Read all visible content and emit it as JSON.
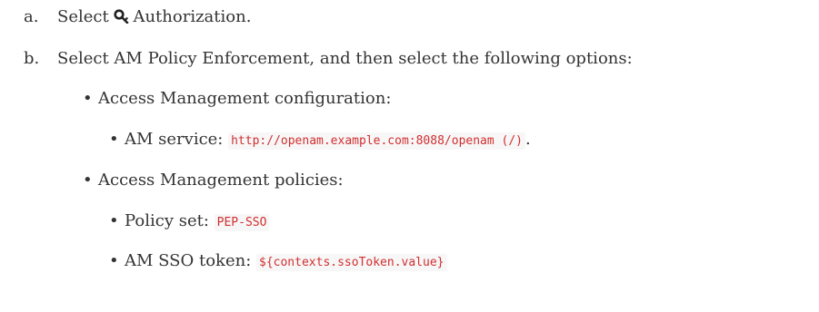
{
  "steps": [
    {
      "marker": "a.",
      "before": "Select",
      "icon": "key-icon",
      "after": "Authorization."
    },
    {
      "marker": "b.",
      "text": "Select AM Policy Enforcement, and then select the following options:"
    }
  ],
  "sections": [
    {
      "label": "Access Management configuration:",
      "items": [
        {
          "label": "AM service:",
          "code": "http://openam.example.com:8088/openam (/)",
          "suffix": "."
        }
      ]
    },
    {
      "label": "Access Management policies:",
      "items": [
        {
          "label": "Policy set:",
          "code": "PEP-SSO",
          "suffix": ""
        },
        {
          "label": "AM SSO token:",
          "code": "${contexts.ssoToken.value}",
          "suffix": ""
        }
      ]
    }
  ],
  "bullet_char": "•",
  "colors": {
    "text": "#333333",
    "code": "#d32f2f",
    "code_bg": "#f7f7f8"
  }
}
